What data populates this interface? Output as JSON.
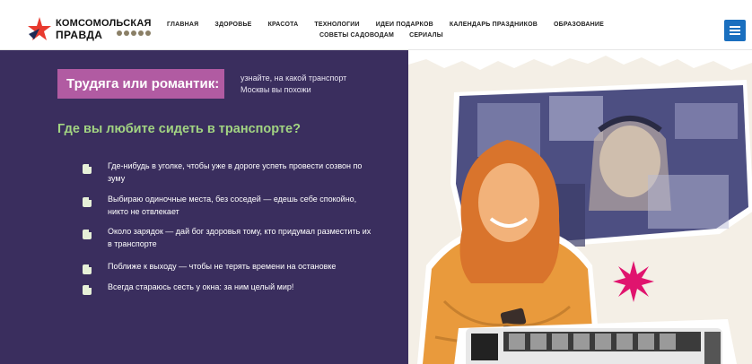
{
  "header": {
    "logo_line1": "КОМСОМОЛЬСКАЯ",
    "logo_line2": "ПРАВДА",
    "nav_row1": [
      "ГЛАВНАЯ",
      "ЗДОРОВЬЕ",
      "КРАСОТА",
      "ТЕХНОЛОГИИ",
      "ИДЕИ ПОДАРКОВ",
      "КАЛЕНДАРЬ ПРАЗДНИКОВ",
      "ОБРАЗОВАНИЕ"
    ],
    "nav_row2": [
      "СОВЕТЫ САДОВОДАМ",
      "СЕРИАЛЫ"
    ],
    "menu_icon": "hamburger-menu-icon"
  },
  "main": {
    "title": "Трудяга или романтик:",
    "subtitle": "узнайте, на какой транспорт Москвы вы похожи",
    "question": "Где вы любите сидеть в транспорте?",
    "options": [
      "Где-нибудь в уголке, чтобы уже в дороге успеть провести созвон по зуму",
      "Выбираю одиночные места, без соседей — едешь себе спокойно, никто не отвлекает",
      "Около зарядок — дай бог здоровья тому, кто придумал разместить их в транспорте",
      "Поближе к выходу — чтобы не терять времени на остановке",
      "Всегда стараюсь сесть у окна: за ним целый мир!"
    ]
  },
  "colors": {
    "panel": "#3a2e5e",
    "title_bg": "#b15ba2",
    "question": "#a2d482",
    "accent_star": "#e0146e",
    "menu_button": "#1a6fbf"
  }
}
